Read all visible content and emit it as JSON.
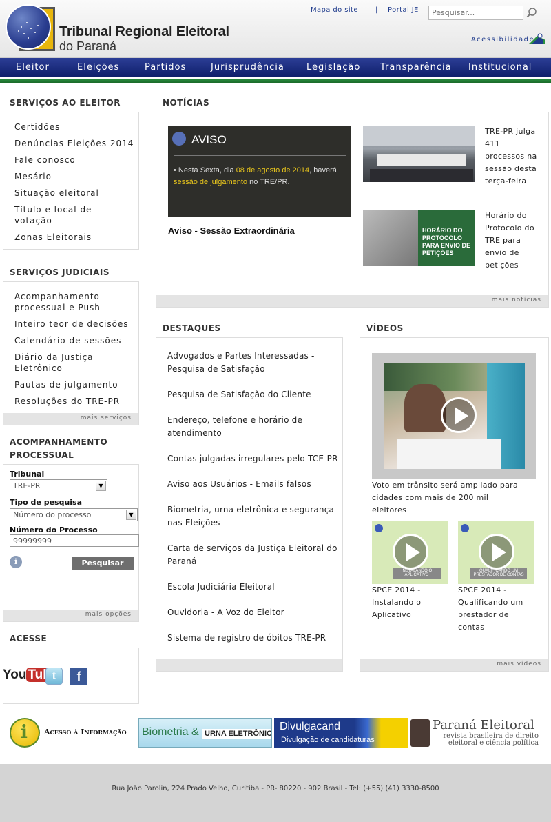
{
  "header": {
    "title_line1": "Tribunal Regional Eleitoral",
    "title_line2": "do Paraná",
    "links": [
      "Mapa do site",
      "|",
      "Portal JE"
    ],
    "search_placeholder": "Pesquisar...",
    "accessibility_label": "Acessibilidade"
  },
  "nav": [
    "Eleitor",
    "Eleições",
    "Partidos",
    "Jurisprudência",
    "Legislação",
    "Transparência",
    "Institucional"
  ],
  "sidebar": {
    "servicos_eleitor": {
      "title": "SERVIÇOS AO ELEITOR",
      "items": [
        "Certidões",
        "Denúncias Eleições 2014",
        "Fale conosco",
        "Mesário",
        "Situação eleitoral",
        "Título e local de votação",
        "Zonas Eleitorais"
      ]
    },
    "servicos_judiciais": {
      "title": "SERVIÇOS JUDICIAIS",
      "items": [
        "Acompanhamento processual e Push",
        "Inteiro teor de decisões",
        "Calendário de sessões",
        "Diário da Justiça Eletrônico",
        "Pautas de julgamento",
        "Resoluções do TRE-PR"
      ],
      "more": "mais serviços"
    },
    "acompanhamento": {
      "title_line1": "ACOMPANHAMENTO",
      "title_line2": "PROCESSUAL",
      "tribunal_label": "Tribunal",
      "tribunal_value": "TRE-PR",
      "tipo_label": "Tipo de pesquisa",
      "tipo_value": "Número do processo",
      "numero_label": "Número do Processo",
      "numero_value": "99999999",
      "info_icon": "i",
      "button": "Pesquisar",
      "more": "mais opções"
    },
    "acesse": {
      "title": "ACESSE",
      "youtube_a": "You",
      "youtube_b": "Tube",
      "twitter": "t",
      "facebook": "f"
    }
  },
  "noticias": {
    "title": "NOTÍCIAS",
    "feature_image": {
      "heading": "AVISO",
      "text_a": "• Nesta Sexta, dia ",
      "text_hl": "08 de agosto de 2014",
      "text_b": ", haverá ",
      "text_hl2": "sessão de julgamento",
      "text_c": " no TRE/PR."
    },
    "feature_caption": "Aviso - Sessão Extraordinária",
    "items": [
      "TRE-PR julga 411 processos na sessão desta terça-feira",
      "Horário do Protocolo do TRE para envio de petições"
    ],
    "thumb2_text": "HORÁRIO DO PROTOCOLO PARA ENVIO DE PETIÇÕES",
    "more": "mais notícias"
  },
  "destaques": {
    "title": "DESTAQUES",
    "items": [
      "Advogados e Partes Interessadas - Pesquisa de Satisfação",
      "Pesquisa de Satisfação do Cliente",
      "Endereço, telefone e horário de atendimento",
      "Contas julgadas irregulares pelo TCE-PR",
      "Aviso aos Usuários - Emails falsos",
      "Biometria, urna eletrônica e segurança nas Eleições",
      "Carta de serviços da Justiça Eleitoral do Paraná",
      "Escola Judiciária Eleitoral",
      "Ouvidoria - A Voz do Eleitor",
      "Sistema de registro de óbitos TRE-PR"
    ]
  },
  "videos": {
    "title": "VÍDEOS",
    "main_caption": "Voto em trânsito será ampliado para cidades com mais de 200 mil eleitores",
    "small": [
      {
        "caption": "SPCE 2014 - Instalando o Aplicativo",
        "thumb_text": "INSTALANDO O APLICATIVO"
      },
      {
        "caption": "SPCE 2014 - Qualificando um prestador de contas",
        "thumb_text": "QUALIFICANDO UM PRESTADOR DE CONTAS"
      }
    ],
    "more": "mais vídeos"
  },
  "banners": {
    "acesso": "Acesso à Informação",
    "acesso_icon": "i",
    "biometria_a": "Biometria",
    "biometria_amp": "&",
    "biometria_b": "URNA ELETRÔNICA",
    "divulgacand_a": "Divulgacand",
    "divulgacand_b": "Divulgação de candidaturas",
    "parana_a": "Paraná Eleitoral",
    "parana_b": "revista brasileira de direito eleitoral e ciência política"
  },
  "footer": {
    "address": "Rua João Parolin, 224 Prado Velho, Curitiba - PR- 80220 - 902 Brasil - Tel: (+55) (41) 3330-8500"
  },
  "colors": {
    "nav_blue": "#1a2a80",
    "nav_green": "#2a9040",
    "link_blue": "#1f3b8c",
    "footer_gray": "#d4d4d4"
  }
}
